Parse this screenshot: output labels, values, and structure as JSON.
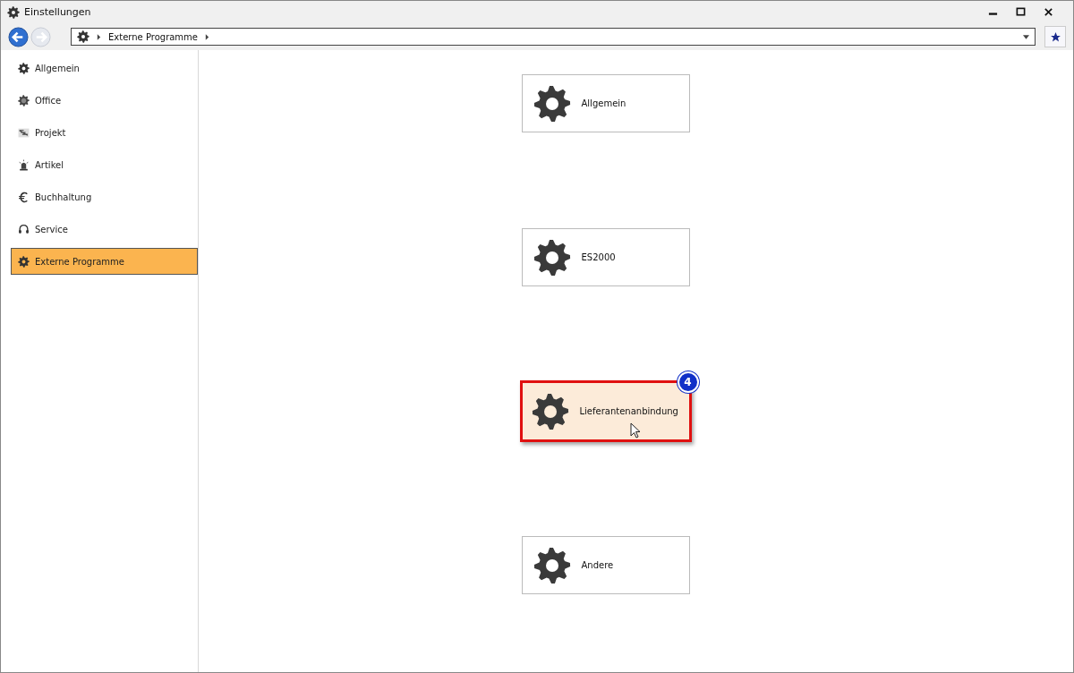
{
  "window": {
    "title": "Einstellungen"
  },
  "breadcrumb": {
    "items": [
      "Externe Programme"
    ]
  },
  "sidebar": {
    "items": [
      {
        "label": "Allgemein",
        "selected": false
      },
      {
        "label": "Office",
        "selected": false
      },
      {
        "label": "Projekt",
        "selected": false
      },
      {
        "label": "Artikel",
        "selected": false
      },
      {
        "label": "Buchhaltung",
        "selected": false
      },
      {
        "label": "Service",
        "selected": false
      },
      {
        "label": "Externe Programme",
        "selected": true
      }
    ]
  },
  "tiles": [
    {
      "label": "Allgemein",
      "selected": false
    },
    {
      "label": "ES2000",
      "selected": false
    },
    {
      "label": "Lieferantenanbindung",
      "selected": true,
      "badge": "4"
    },
    {
      "label": "Andere",
      "selected": false
    }
  ]
}
